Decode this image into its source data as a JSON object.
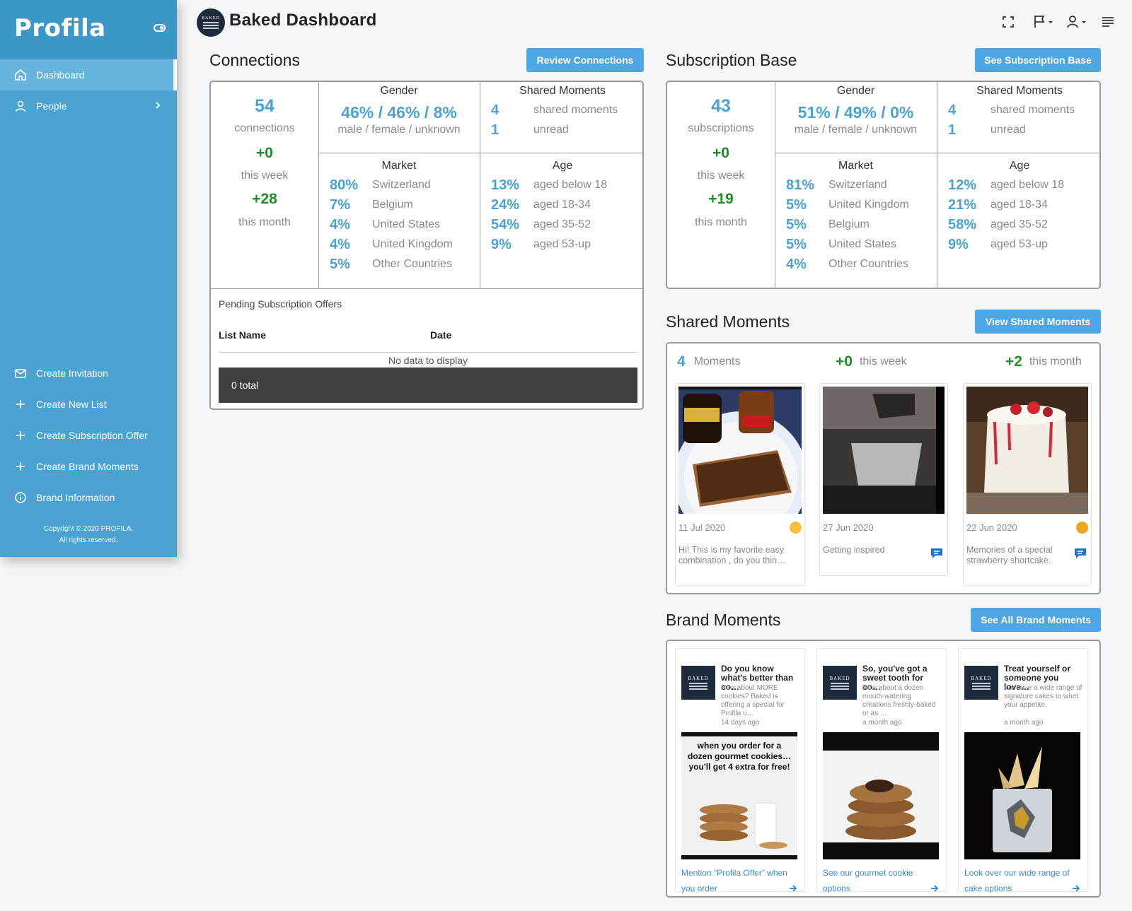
{
  "sidebar": {
    "logo": "Profila",
    "nav": [
      {
        "label": "Dashboard",
        "icon": "home-icon"
      },
      {
        "label": "People",
        "icon": "person-icon"
      }
    ],
    "actions": [
      {
        "label": "Create Invitation",
        "icon": "mail-icon"
      },
      {
        "label": "Create New List",
        "icon": "plus-icon"
      },
      {
        "label": "Create Subscription Offer",
        "icon": "plus-icon"
      },
      {
        "label": "Create Brand Moments",
        "icon": "plus-icon"
      },
      {
        "label": "Brand Information",
        "icon": "info-icon"
      }
    ],
    "copyright_line1": "Copyright © 2020 PROFILA.",
    "copyright_line2": "All rights reserved."
  },
  "header": {
    "title": "Baked Dashboard",
    "logo_text": "BAKED"
  },
  "connections": {
    "title": "Connections",
    "button": "Review Connections",
    "total": "54",
    "total_label": "connections",
    "week": "+0",
    "week_label": "this week",
    "month": "+28",
    "month_label": "this month",
    "gender_title": "Gender",
    "gender_values": "46% / 46% / 8%",
    "gender_labels": "male / female / unknown",
    "shared_title": "Shared Moments",
    "shared": [
      {
        "value": "4",
        "label": "shared moments"
      },
      {
        "value": "1",
        "label": "unread"
      }
    ],
    "market_title": "Market",
    "market": [
      {
        "pct": "80%",
        "label": "Switzerland"
      },
      {
        "pct": "7%",
        "label": "Belgium"
      },
      {
        "pct": "4%",
        "label": "United States"
      },
      {
        "pct": "4%",
        "label": "United Kingdom"
      },
      {
        "pct": "5%",
        "label": "Other Countries"
      }
    ],
    "age_title": "Age",
    "age": [
      {
        "pct": "13%",
        "label": "aged below 18"
      },
      {
        "pct": "24%",
        "label": "aged 18-34"
      },
      {
        "pct": "54%",
        "label": "aged 35-52"
      },
      {
        "pct": "9%",
        "label": "aged 53-up"
      }
    ],
    "pending_title": "Pending Subscription Offers",
    "col_list": "List Name",
    "col_date": "Date",
    "empty": "No data to display",
    "footer_total": "0 total"
  },
  "subscription": {
    "title": "Subscription Base",
    "button": "See Subscription Base",
    "total": "43",
    "total_label": "subscriptions",
    "week": "+0",
    "week_label": "this week",
    "month": "+19",
    "month_label": "this month",
    "gender_title": "Gender",
    "gender_values": "51% / 49% / 0%",
    "gender_labels": "male / female / unknown",
    "shared_title": "Shared Moments",
    "shared": [
      {
        "value": "4",
        "label": "shared moments"
      },
      {
        "value": "1",
        "label": "unread"
      }
    ],
    "market_title": "Market",
    "market": [
      {
        "pct": "81%",
        "label": "Switzerland"
      },
      {
        "pct": "5%",
        "label": "United Kingdom"
      },
      {
        "pct": "5%",
        "label": "Belgium"
      },
      {
        "pct": "5%",
        "label": "United States"
      },
      {
        "pct": "4%",
        "label": "Other Countries"
      }
    ],
    "age_title": "Age",
    "age": [
      {
        "pct": "12%",
        "label": "aged below 18"
      },
      {
        "pct": "21%",
        "label": "aged 18-34"
      },
      {
        "pct": "58%",
        "label": "aged 35-52"
      },
      {
        "pct": "9%",
        "label": "aged 53-up"
      }
    ]
  },
  "shared_moments": {
    "title": "Shared Moments",
    "button": "View Shared Moments",
    "count": "4",
    "count_label": "Moments",
    "week": "+0",
    "week_label": "this week",
    "month": "+2",
    "month_label": "this month",
    "cards": [
      {
        "date": "11 Jul 2020",
        "caption": "Hi! This is my favorite easy combination , do you thin…"
      },
      {
        "date": "27 Jun 2020",
        "caption": "Getting inspired"
      },
      {
        "date": "22 Jun 2020",
        "caption": "Memories of a special strawberry shortcake."
      }
    ],
    "colors": {
      "accent": "#4aa3d1",
      "green": "#1c8f28"
    }
  },
  "brand_moments": {
    "title": "Brand Moments",
    "button": "See All Brand Moments",
    "logo_text": "BAKED",
    "cards": [
      {
        "title": "Do you know what's better than co…",
        "desc": "How about MORE cookies? Baked is offering a special for Profila u…",
        "ago": "14 days ago",
        "img_text": "when you order for a dozen gourmet cookies… you'll get 4 extra for free!",
        "link": "Mention “Profila Offer” when you order"
      },
      {
        "title": "So, you've got a sweet tooth for co…",
        "desc": "How about a dozen mouth-watering creations freshly-baked or as …",
        "ago": "a month ago",
        "img_text": "",
        "link": "See our gourmet cookie options"
      },
      {
        "title": "Treat yourself or someone you love…",
        "desc": "We have a wide range of signature cakes to whet your appetite.",
        "ago": "a month ago",
        "img_text": "",
        "link": "Look over our wide range of cake options"
      }
    ]
  }
}
